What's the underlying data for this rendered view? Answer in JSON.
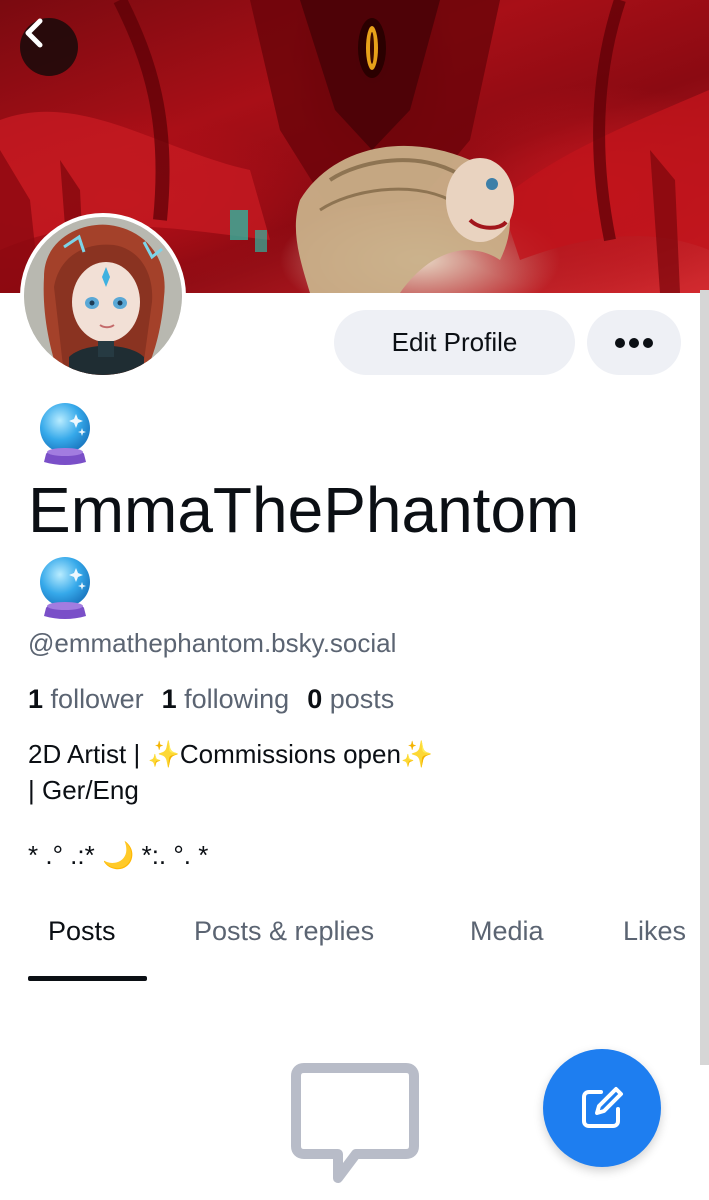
{
  "header": {
    "back_icon": "chevron-left-icon"
  },
  "profile": {
    "display_name": "EmmaThePhantom",
    "name_emoji": "crystal-ball-icon",
    "handle": "@emmathephantom.bsky.social",
    "stats": {
      "followers_count": "1",
      "followers_label": "follower",
      "following_count": "1",
      "following_label": "following",
      "posts_count": "0",
      "posts_label": "posts"
    },
    "bio": {
      "line1_prefix": "2D Artist | ",
      "line1_main": "Commissions open",
      "line2": "| Ger/Eng",
      "decor_left": "* .° .:* ",
      "decor_right": " *:. °. *"
    }
  },
  "actions": {
    "edit_profile_label": "Edit Profile",
    "more_label": "•••"
  },
  "tabs": [
    {
      "label": "Posts",
      "active": true
    },
    {
      "label": "Posts & replies",
      "active": false
    },
    {
      "label": "Media",
      "active": false
    },
    {
      "label": "Likes",
      "active": false
    }
  ],
  "empty_state": {
    "icon": "message-bubble-icon"
  },
  "fab": {
    "icon": "compose-icon"
  },
  "colors": {
    "accent": "#1e7ef0",
    "banner_red": "#a80f17",
    "muted_text": "#5b6472",
    "button_bg": "#eef0f5"
  }
}
